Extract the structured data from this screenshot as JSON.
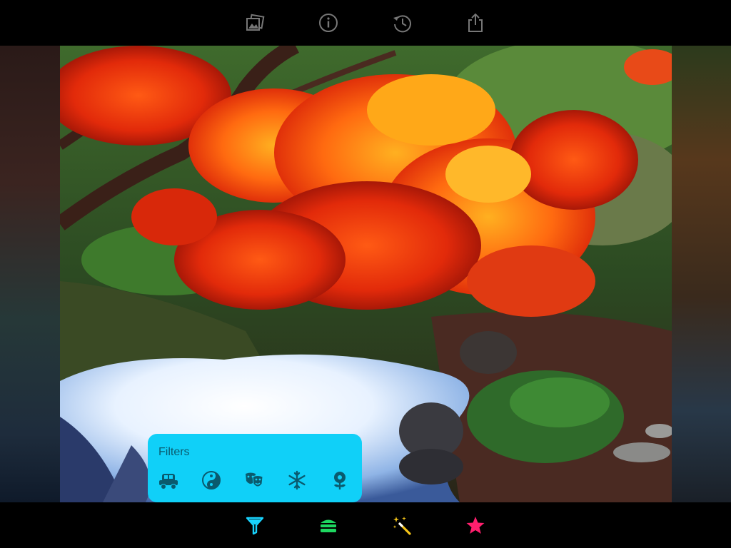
{
  "toolbar_top": {
    "items": [
      {
        "name": "photos-icon"
      },
      {
        "name": "info-icon"
      },
      {
        "name": "history-icon"
      },
      {
        "name": "share-icon"
      }
    ]
  },
  "photo": {
    "description_icon": "autumn-maple-pond-photo"
  },
  "filters_popover": {
    "title": "Filters",
    "items": [
      {
        "name": "vintage-car-filter-icon"
      },
      {
        "name": "yin-yang-filter-icon"
      },
      {
        "name": "drama-masks-filter-icon"
      },
      {
        "name": "snowflake-filter-icon"
      },
      {
        "name": "flower-filter-icon"
      }
    ],
    "background_color": "#10d0f8"
  },
  "toolbar_bottom": {
    "items": [
      {
        "name": "filter-funnel-icon",
        "color": "#18d4ff",
        "selected": true
      },
      {
        "name": "layers-icon",
        "color": "#1ed760"
      },
      {
        "name": "magic-wand-icon",
        "color": "#f5c518"
      },
      {
        "name": "star-icon",
        "color": "#ff1f6e"
      }
    ]
  }
}
